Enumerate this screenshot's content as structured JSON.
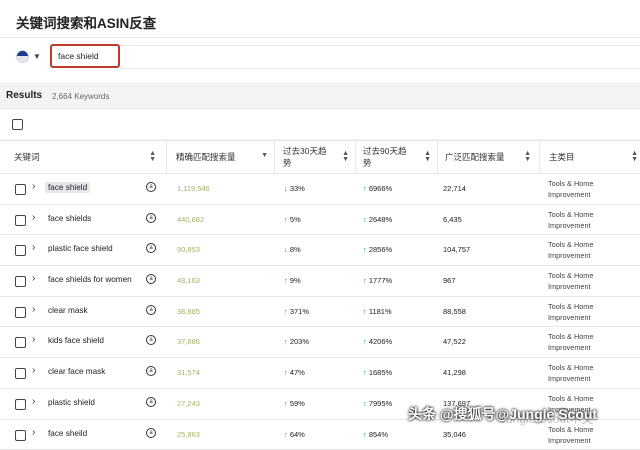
{
  "header": {
    "title": "关键词搜索和ASIN反查"
  },
  "search": {
    "value": "face shield",
    "marketplace_icon": "us-flag-icon"
  },
  "results": {
    "label": "Results",
    "count": "2,664 Keywords"
  },
  "columns": [
    "关键词",
    "精确匹配搜索量",
    "过去30天趋势",
    "过去90天趋势",
    "广泛匹配搜索量",
    "主类目"
  ],
  "rows": [
    {
      "keyword": "face shield",
      "exact": "1,119,546",
      "t30_dir": "down",
      "t30": "33%",
      "t90_dir": "up",
      "t90": "6966%",
      "broad": "22,714",
      "cat": "Tools & Home Improvement"
    },
    {
      "keyword": "face shields",
      "exact": "440,882",
      "t30_dir": "up",
      "t30": "5%",
      "t90_dir": "up",
      "t90": "2648%",
      "broad": "6,435",
      "cat": "Tools & Home Improvement"
    },
    {
      "keyword": "plastic face shield",
      "exact": "90,853",
      "t30_dir": "down",
      "t30": "8%",
      "t90_dir": "up",
      "t90": "2856%",
      "broad": "104,757",
      "cat": "Tools & Home Improvement"
    },
    {
      "keyword": "face shields for women",
      "exact": "48,163",
      "t30_dir": "up",
      "t30": "9%",
      "t90_dir": "up",
      "t90": "1777%",
      "broad": "967",
      "cat": "Tools & Home Improvement"
    },
    {
      "keyword": "clear mask",
      "exact": "38,885",
      "t30_dir": "up",
      "t30": "371%",
      "t90_dir": "up",
      "t90": "1181%",
      "broad": "88,558",
      "cat": "Tools & Home Improvement"
    },
    {
      "keyword": "kids face shield",
      "exact": "37,886",
      "t30_dir": "up",
      "t30": "203%",
      "t90_dir": "up",
      "t90": "4206%",
      "broad": "47,522",
      "cat": "Tools & Home Improvement"
    },
    {
      "keyword": "clear face mask",
      "exact": "31,574",
      "t30_dir": "up",
      "t30": "47%",
      "t90_dir": "up",
      "t90": "1685%",
      "broad": "41,298",
      "cat": "Tools & Home Improvement"
    },
    {
      "keyword": "plastic shield",
      "exact": "27,243",
      "t30_dir": "up",
      "t30": "59%",
      "t90_dir": "up",
      "t90": "7995%",
      "broad": "137,697",
      "cat": "Tools & Home Improvement"
    },
    {
      "keyword": "face sheild",
      "exact": "25,863",
      "t30_dir": "up",
      "t30": "64%",
      "t90_dir": "up",
      "t90": "854%",
      "broad": "35,046",
      "cat": "Tools & Home Improvement"
    }
  ],
  "watermark": {
    "text": "头条 @搜狐号@Jungle Scout",
    "faint": "Jungle Scout中文"
  }
}
